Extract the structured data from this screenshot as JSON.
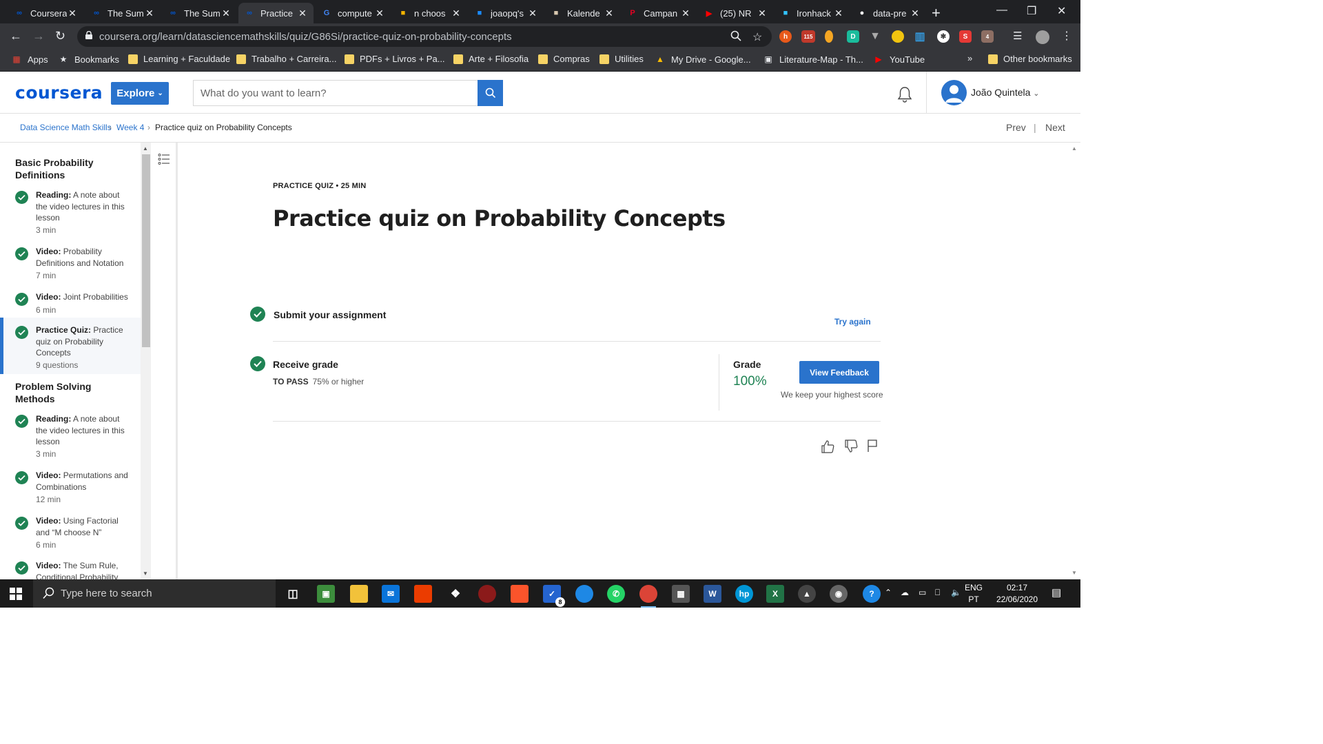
{
  "browser": {
    "tabs": [
      {
        "title": "Coursera",
        "favicon": "coursera-icon",
        "color": "#0056d2"
      },
      {
        "title": "The Sum",
        "favicon": "coursera-icon",
        "color": "#0056d2"
      },
      {
        "title": "The Sum",
        "favicon": "coursera-icon",
        "color": "#0056d2"
      },
      {
        "title": "Practice",
        "favicon": "coursera-icon",
        "color": "#0056d2",
        "active": true
      },
      {
        "title": "compute",
        "favicon": "google-icon",
        "color": "#4285f4"
      },
      {
        "title": "n choos",
        "favicon": "gem-icon",
        "color": "#f4b400"
      },
      {
        "title": "joaopq's",
        "favicon": "parallelogram-icon",
        "color": "#1a8cff"
      },
      {
        "title": "Kalende",
        "favicon": "calendar-icon",
        "color": "#d8c8b0"
      },
      {
        "title": "Campan",
        "favicon": "pinterest-icon",
        "color": "#e60023"
      },
      {
        "title": "(25) NR",
        "favicon": "youtube-icon",
        "color": "#ff0000"
      },
      {
        "title": "Ironhack",
        "favicon": "ironhack-icon",
        "color": "#32c3ff"
      },
      {
        "title": "data-pre",
        "favicon": "github-icon",
        "color": "#ffffff"
      }
    ],
    "url": "coursera.org/learn/datasciencemathskills/quiz/G86Si/practice-quiz-on-probability-concepts",
    "extensions": {
      "ext_badge_1": "115",
      "ext_badge_2": "4"
    },
    "bookmarks": [
      {
        "label": "Apps",
        "icon": "apps-grid-icon"
      },
      {
        "label": "Bookmarks",
        "icon": "star-icon"
      },
      {
        "label": "Learning + Faculdade",
        "icon": "folder-icon"
      },
      {
        "label": "Trabalho + Carreira...",
        "icon": "folder-icon"
      },
      {
        "label": "PDFs + Livros + Pa...",
        "icon": "folder-icon"
      },
      {
        "label": "Arte + Filosofia",
        "icon": "folder-icon"
      },
      {
        "label": "Compras",
        "icon": "folder-icon"
      },
      {
        "label": "Utilities",
        "icon": "folder-icon"
      },
      {
        "label": "My Drive - Google...",
        "icon": "drive-icon"
      },
      {
        "label": "Literature-Map - Th...",
        "icon": "literature-map-icon"
      },
      {
        "label": "YouTube",
        "icon": "youtube-icon"
      }
    ],
    "overflow": "»",
    "other_bookmarks": "Other bookmarks"
  },
  "header": {
    "logo": "coursera",
    "explore": "Explore",
    "search_placeholder": "What do you want to learn?",
    "user_name": "João Quintela"
  },
  "breadcrumb": {
    "course": "Data Science Math Skills",
    "week": "Week 4",
    "current": "Practice quiz on Probability Concepts",
    "prev": "Prev",
    "next": "Next"
  },
  "sidebar": {
    "section1": "Basic Probability Definitions",
    "section2": "Problem Solving Methods",
    "items": [
      {
        "type": "Reading:",
        "title": "A note about the video lectures in this lesson",
        "duration": "3 min"
      },
      {
        "type": "Video:",
        "title": "Probability Definitions and Notation",
        "duration": "7 min"
      },
      {
        "type": "Video:",
        "title": "Joint Probabilities",
        "duration": "6 min"
      },
      {
        "type": "Practice Quiz:",
        "title": "Practice quiz on Probability Concepts",
        "duration": "9 questions"
      },
      {
        "type": "Reading:",
        "title": "A note about the video lectures in this lesson",
        "duration": "3 min"
      },
      {
        "type": "Video:",
        "title": "Permutations and Combinations",
        "duration": "12 min"
      },
      {
        "type": "Video:",
        "title": "Using Factorial and “M choose N”",
        "duration": "6 min"
      },
      {
        "type": "Video:",
        "title": "The Sum Rule, Conditional Probability",
        "duration": ""
      }
    ]
  },
  "quiz": {
    "kicker": "PRACTICE QUIZ • 25 MIN",
    "title": "Practice quiz on Probability Concepts",
    "submit_label": "Submit your assignment",
    "try_again": "Try again",
    "receive_label": "Receive grade",
    "to_pass_label": "TO PASS",
    "to_pass_value": "75% or higher",
    "grade_label": "Grade",
    "grade_value": "100%",
    "view_feedback": "View Feedback",
    "keep_note": "We keep your highest score"
  },
  "taskbar": {
    "search_placeholder": "Type here to search",
    "badge": "8",
    "lang_top": "ENG",
    "lang_bottom": "PT",
    "time": "02:17",
    "date": "22/06/2020"
  },
  "colors": {
    "brand_blue": "#0056d2",
    "button_blue": "#2a73cc",
    "success_green": "#1f8354"
  }
}
